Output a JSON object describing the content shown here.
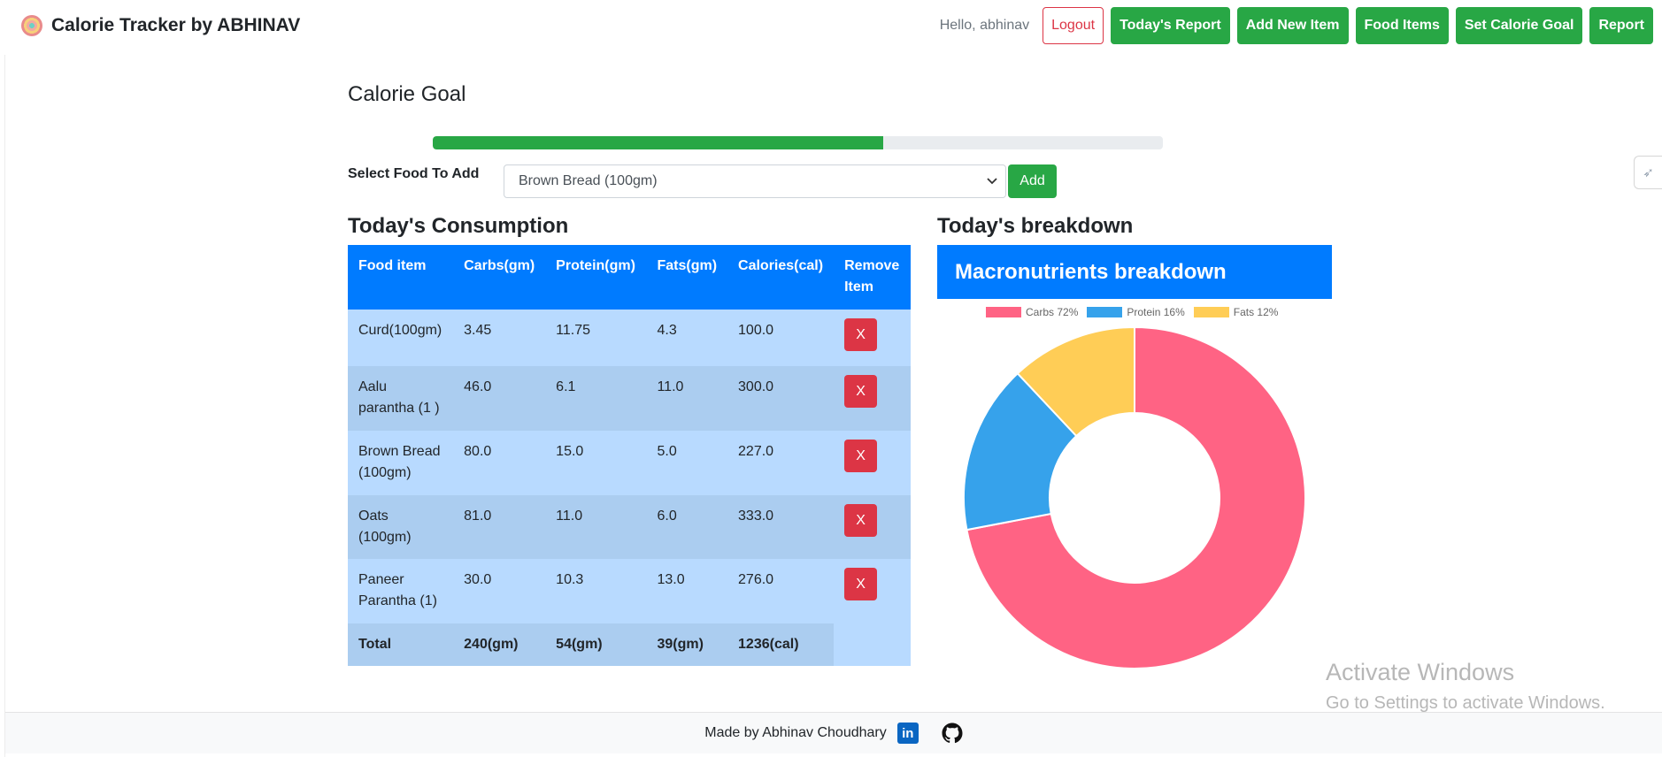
{
  "nav": {
    "title": "Calorie Tracker by ABHINAV",
    "greeting": "Hello, abhinav",
    "logout": "Logout",
    "buttons": [
      "Today's Report",
      "Add New Item",
      "Food Items",
      "Set Calorie Goal",
      "Report"
    ]
  },
  "goal": {
    "title": "Calorie Goal",
    "progress_fraction": 0.617
  },
  "select": {
    "label": "Select Food To Add",
    "value": "Brown Bread (100gm)",
    "add_label": "Add"
  },
  "consumption": {
    "title": "Today's Consumption",
    "headers": [
      "Food item",
      "Carbs(gm)",
      "Protein(gm)",
      "Fats(gm)",
      "Calories(cal)",
      "Remove Item"
    ],
    "rows": [
      {
        "food": "Curd(100gm)",
        "carbs": "3.45",
        "protein": "11.75",
        "fats": "4.3",
        "calories": "100.0",
        "remove": "X"
      },
      {
        "food": "Aalu parantha (1 )",
        "carbs": "46.0",
        "protein": "6.1",
        "fats": "11.0",
        "calories": "300.0",
        "remove": "X"
      },
      {
        "food": "Brown Bread (100gm)",
        "carbs": "80.0",
        "protein": "15.0",
        "fats": "5.0",
        "calories": "227.0",
        "remove": "X"
      },
      {
        "food": "Oats (100gm)",
        "carbs": "81.0",
        "protein": "11.0",
        "fats": "6.0",
        "calories": "333.0",
        "remove": "X"
      },
      {
        "food": "Paneer Parantha (1)",
        "carbs": "30.0",
        "protein": "10.3",
        "fats": "13.0",
        "calories": "276.0",
        "remove": "X"
      }
    ],
    "total": {
      "label": "Total",
      "carbs": "240(gm)",
      "protein": "54(gm)",
      "fats": "39(gm)",
      "calories": "1236(cal)"
    }
  },
  "breakdown": {
    "title": "Today's breakdown",
    "header": "Macronutrients breakdown"
  },
  "chart_data": {
    "type": "pie",
    "donut": true,
    "categories": [
      "Carbs 72%",
      "Protein 16%",
      "Fats 12%"
    ],
    "values": [
      72,
      16,
      12
    ],
    "colors": [
      "#ff6384",
      "#36a2eb",
      "#ffcd56"
    ],
    "legend": "top"
  },
  "watermark": {
    "line1": "Activate Windows",
    "line2": "Go to Settings to activate Windows."
  },
  "footer": {
    "text": "Made by Abhinav Choudhary",
    "icons": [
      "linkedin-icon",
      "github-icon"
    ]
  }
}
